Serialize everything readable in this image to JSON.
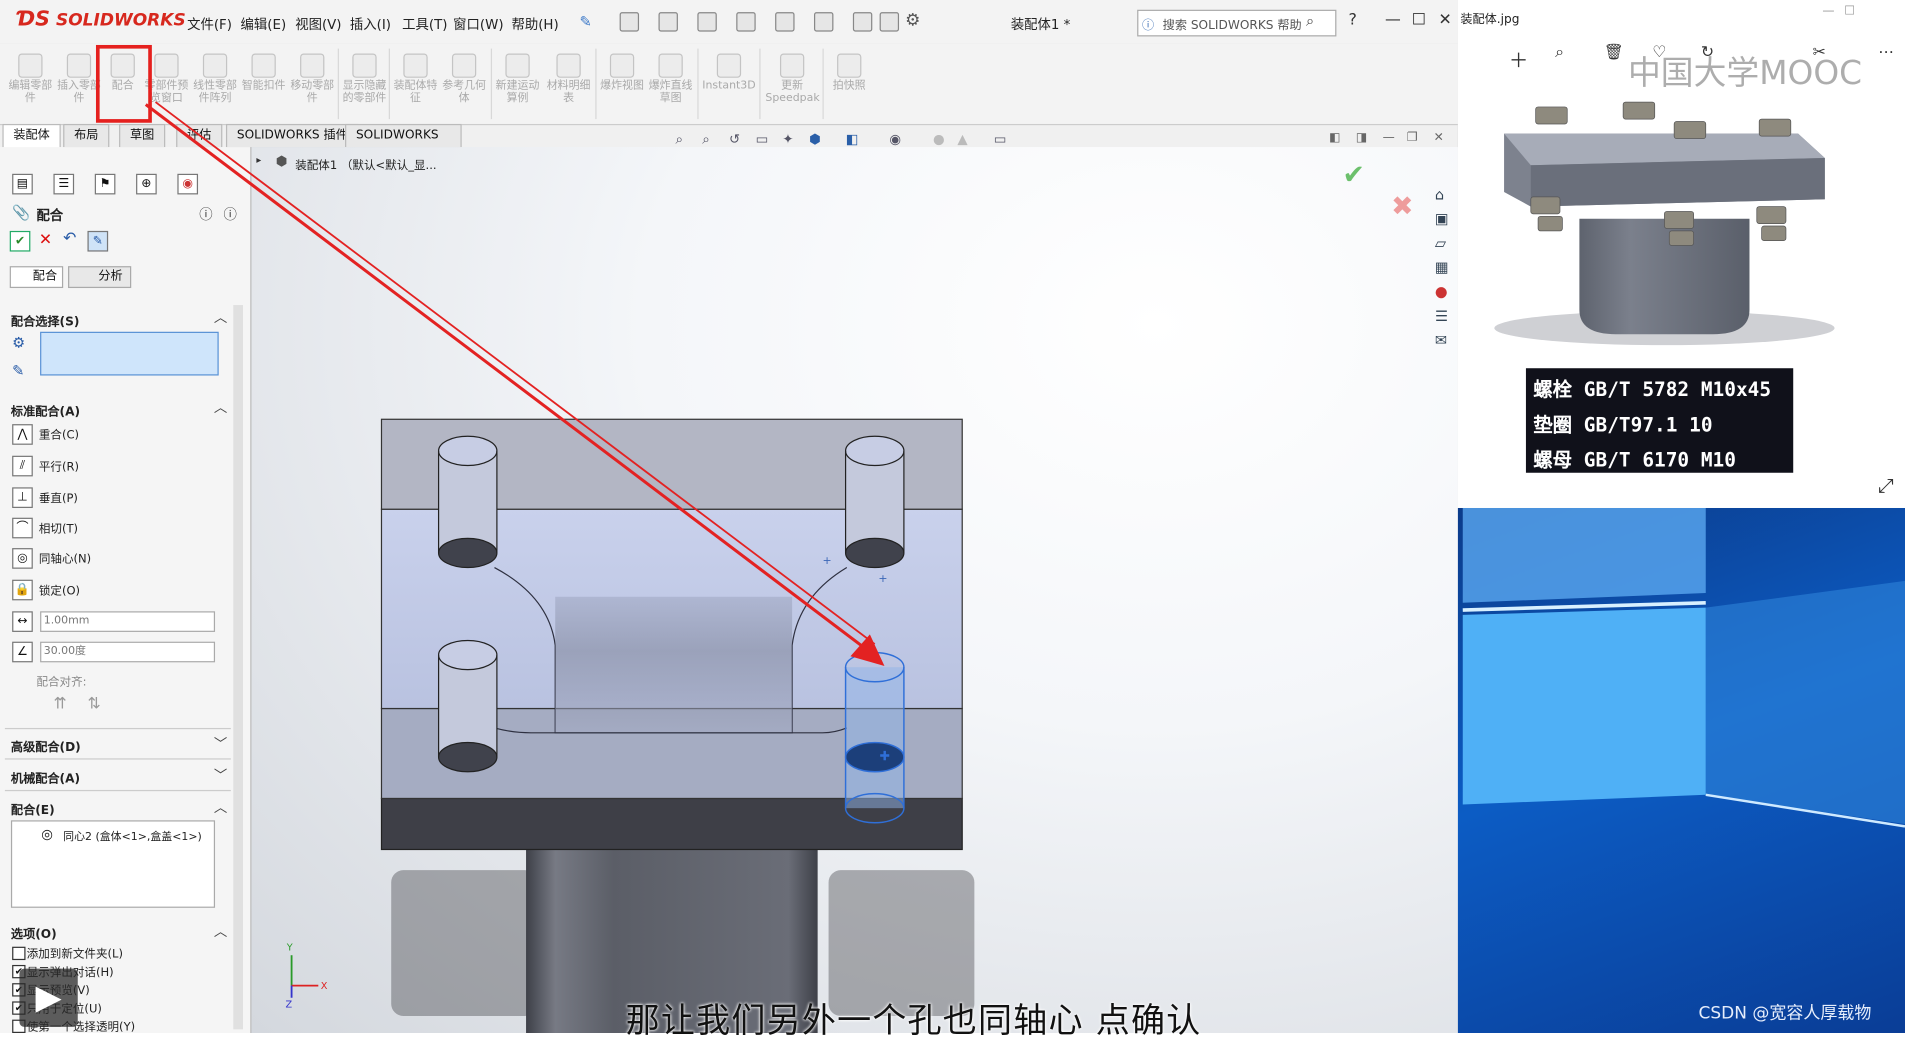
{
  "app": {
    "brand": "SOLIDWORKS",
    "menu": [
      "文件(F)",
      "编辑(E)",
      "视图(V)",
      "插入(I)",
      "工具(T)",
      "窗口(W)",
      "帮助(H)"
    ],
    "document_title": "装配体1 *",
    "help_search_placeholder": "搜索 SOLIDWORKS 帮助",
    "help_label": "?"
  },
  "command_manager": {
    "buttons": [
      "编辑零部件",
      "插入零部件",
      "配合",
      "零部件预览窗口",
      "线性零部件阵列",
      "智能扣件",
      "移动零部件",
      "显示隐藏的零部件",
      "装配体特征",
      "参考几何体",
      "新建运动算例",
      "材料明细表",
      "爆炸视图",
      "爆炸直线草图",
      "Instant3D",
      "更新Speedpak",
      "拍快照"
    ]
  },
  "tabs": [
    "装配体",
    "布局",
    "草图",
    "评估",
    "SOLIDWORKS 插件",
    "SOLIDWORKS MBD"
  ],
  "active_tab": "装配体",
  "tree": {
    "root": "装配体1 （默认<默认_显..."
  },
  "property_manager": {
    "title": "配合",
    "subtabs": [
      "配合",
      "分析"
    ],
    "sections": {
      "mate_selection": "配合选择(S)",
      "standard_mates": "标准配合(A)",
      "advanced_mates": "高级配合(D)",
      "mechanical_mates": "机械配合(A)",
      "mates": "配合(E)",
      "options": "选项(O)"
    },
    "standard_mates": [
      "重合(C)",
      "平行(R)",
      "垂直(P)",
      "相切(T)",
      "同轴心(N)",
      "锁定(O)"
    ],
    "distance_value": "1.00mm",
    "angle_value": "30.00度",
    "mate_alignment_label": "配合对齐:",
    "mates_list": [
      "同心2 (盒体<1>,盒盖<1>)"
    ],
    "options": [
      {
        "label": "添加到新文件夹(L)",
        "checked": false
      },
      {
        "label": "显示弹出对话(H)",
        "checked": true
      },
      {
        "label": "显示预览(V)",
        "checked": true
      },
      {
        "label": "只用于定位(U)",
        "checked": true
      },
      {
        "label": "使第一个选择透明(Y)",
        "checked": false
      }
    ]
  },
  "viewport": {
    "triad_x": "X",
    "triad_y": "Y",
    "triad_z": "Z"
  },
  "photo_viewer": {
    "title": "装配体.jpg",
    "watermark": "中国大学MOOC",
    "spec_lines": [
      "螺栓 GB/T 5782 M10x45",
      "垫圈 GB/T97.1 10",
      "螺母 GB/T 6170 M10"
    ]
  },
  "overlay": {
    "subtitle": "那让我们另外一个孔也同轴心 点确认",
    "csdn": "CSDN @宽容人厚载物"
  }
}
